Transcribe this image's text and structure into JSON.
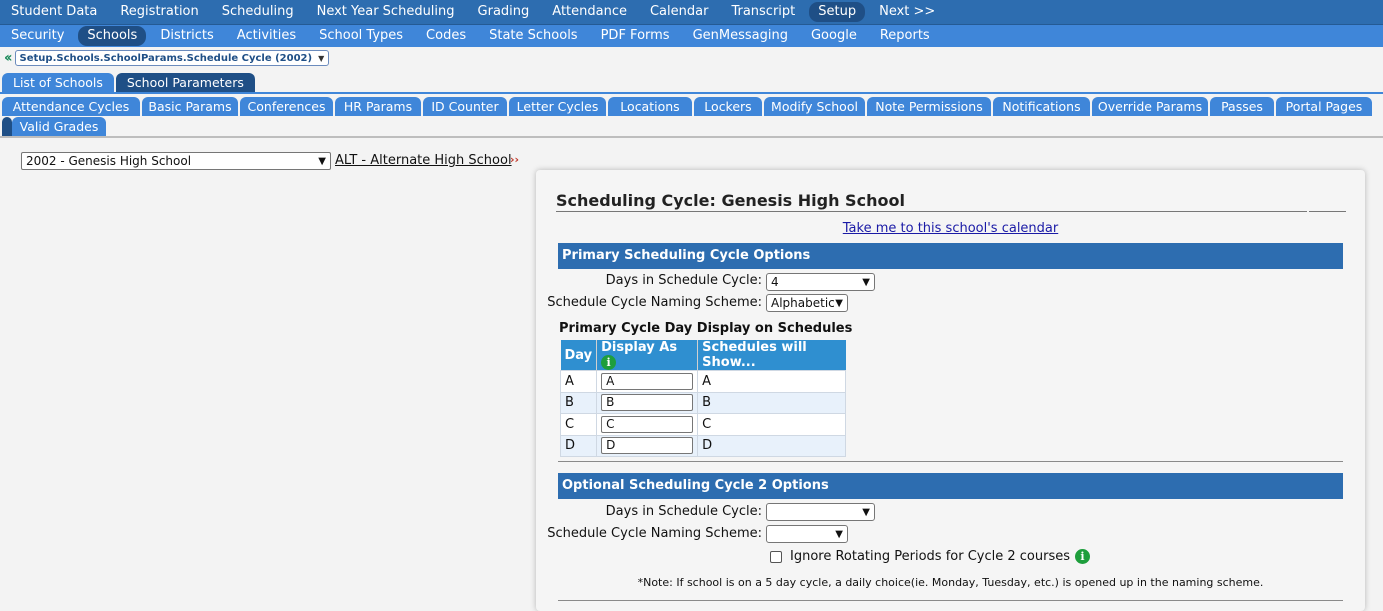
{
  "nav_primary": [
    {
      "label": "Student Data",
      "active": false
    },
    {
      "label": "Registration",
      "active": false
    },
    {
      "label": "Scheduling",
      "active": false
    },
    {
      "label": "Next Year Scheduling",
      "active": false
    },
    {
      "label": "Grading",
      "active": false
    },
    {
      "label": "Attendance",
      "active": false
    },
    {
      "label": "Calendar",
      "active": false
    },
    {
      "label": "Transcript",
      "active": false
    },
    {
      "label": "Setup",
      "active": true
    },
    {
      "label": "Next >>",
      "active": false
    }
  ],
  "nav_secondary": [
    {
      "label": "Security",
      "active": false
    },
    {
      "label": "Schools",
      "active": true
    },
    {
      "label": "Districts",
      "active": false
    },
    {
      "label": "Activities",
      "active": false
    },
    {
      "label": "School Types",
      "active": false
    },
    {
      "label": "Codes",
      "active": false
    },
    {
      "label": "State Schools",
      "active": false
    },
    {
      "label": "PDF Forms",
      "active": false
    },
    {
      "label": "GenMessaging",
      "active": false
    },
    {
      "label": "Google",
      "active": false
    },
    {
      "label": "Reports",
      "active": false
    }
  ],
  "breadcrumb": {
    "value": "Setup.Schools.SchoolParams.Schedule Cycle (2002)"
  },
  "tabs_level1": [
    {
      "label": "List of Schools",
      "active": false
    },
    {
      "label": "School Parameters",
      "active": true
    }
  ],
  "tabs_level2": [
    {
      "label": "Attendance Cycles"
    },
    {
      "label": "Basic Params"
    },
    {
      "label": "Conferences"
    },
    {
      "label": "HR Params"
    },
    {
      "label": "ID Counter"
    },
    {
      "label": "Letter Cycles"
    },
    {
      "label": "Locations"
    },
    {
      "label": "Lockers"
    },
    {
      "label": "Modify School"
    },
    {
      "label": "Note Permissions"
    },
    {
      "label": "Notifications"
    },
    {
      "label": "Override Params"
    },
    {
      "label": "Passes"
    },
    {
      "label": "Portal Pages"
    },
    {
      "label": ""
    },
    {
      "label": "Valid Grades"
    }
  ],
  "school_selector": {
    "value": "2002 - Genesis High School",
    "alt_link": "ALT - Alternate High School"
  },
  "panel": {
    "title": "Scheduling Cycle: Genesis High School",
    "calendar_link": "Take me to this school's calendar",
    "primary": {
      "header": "Primary Scheduling Cycle Options",
      "days_label": "Days in Schedule Cycle:",
      "days_value": "4",
      "naming_label": "Schedule Cycle Naming Scheme:",
      "naming_value": "Alphabetic",
      "display_heading": "Primary Cycle Day Display on Schedules",
      "table": {
        "col_day": "Day",
        "col_display": "Display As",
        "col_show": "Schedules will Show...",
        "rows": [
          {
            "day": "A",
            "display": "A",
            "show": "A"
          },
          {
            "day": "B",
            "display": "B",
            "show": "B"
          },
          {
            "day": "C",
            "display": "C",
            "show": "C"
          },
          {
            "day": "D",
            "display": "D",
            "show": "D"
          }
        ]
      }
    },
    "optional": {
      "header": "Optional Scheduling Cycle 2 Options",
      "days_label": "Days in Schedule Cycle:",
      "days_value": "",
      "naming_label": "Schedule Cycle Naming Scheme:",
      "naming_value": "",
      "ignore_label": "Ignore Rotating Periods for Cycle 2 courses",
      "ignore_checked": false
    },
    "note": "*Note: If school is on a 5 day cycle, a daily choice(ie. Monday, Tuesday, etc.) is opened up in the naming scheme."
  },
  "colors": {
    "nav_primary_bg": "#2d6db0",
    "nav_secondary_bg": "#3f86d9",
    "active_pill": "#1f4f86",
    "table_header": "#2f8fd0",
    "info_icon": "#1e9e3c"
  }
}
